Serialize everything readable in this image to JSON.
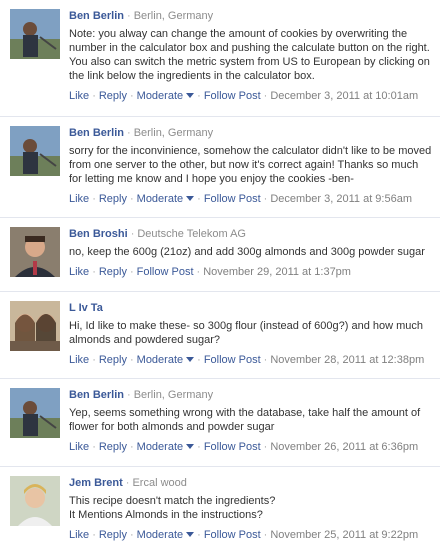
{
  "comments": [
    {
      "author": "Ben Berlin",
      "affiliation": "Berlin, Germany",
      "avatar": "man-outdoors-photo",
      "text": "Note: you alway can change the amount of cookies by overwriting the number in the calculator box and pushing the calculate button on the right. You also can switch the metric system from US to European by clicking on the link below the ingredients in the calculator box.",
      "actions": [
        "Like",
        "Reply",
        "Moderate",
        "Follow Post"
      ],
      "date": "December 3, 2011 at 10:01am"
    },
    {
      "author": "Ben Berlin",
      "affiliation": "Berlin, Germany",
      "avatar": "man-outdoors-photo",
      "text": "sorry for the inconvinience, somehow the calculator didn't like to be moved from one server to the other, but now it's correct again! Thanks so much for letting me know and I hope you enjoy the cookies -ben-",
      "actions": [
        "Like",
        "Reply",
        "Moderate",
        "Follow Post"
      ],
      "date": "December 3, 2011 at 9:56am"
    },
    {
      "author": "Ben Broshi",
      "affiliation": "Deutsche Telekom AG",
      "avatar": "man-portrait-photo",
      "text": "no, keep the 600g (21oz) and add 300g almonds and 300g powder sugar",
      "actions": [
        "Like",
        "Reply",
        "Follow Post"
      ],
      "date": "November 29, 2011 at 1:37pm"
    },
    {
      "author": "L Iv Ta",
      "affiliation": "",
      "avatar": "two-women-photo",
      "text": "Hi, Id like to make these- so 300g flour (instead of 600g?) and how much almonds and powdered sugar?",
      "actions": [
        "Like",
        "Reply",
        "Moderate",
        "Follow Post"
      ],
      "date": "November 28, 2011 at 12:38pm"
    },
    {
      "author": "Ben Berlin",
      "affiliation": "Berlin, Germany",
      "avatar": "man-outdoors-photo",
      "text": "Yep, seems something wrong with the database, take half the amount of flower for both almonds and powder sugar",
      "actions": [
        "Like",
        "Reply",
        "Moderate",
        "Follow Post"
      ],
      "date": "November 26, 2011 at 6:36pm"
    },
    {
      "author": "Jem Brent",
      "affiliation": "Ercal wood",
      "avatar": "blond-man-photo",
      "text": "This recipe doesn't match the ingredients?\nIt Mentions Almonds in the instructions?",
      "actions": [
        "Like",
        "Reply",
        "Moderate",
        "Follow Post"
      ],
      "date": "November 25, 2011 at 9:22pm"
    }
  ]
}
